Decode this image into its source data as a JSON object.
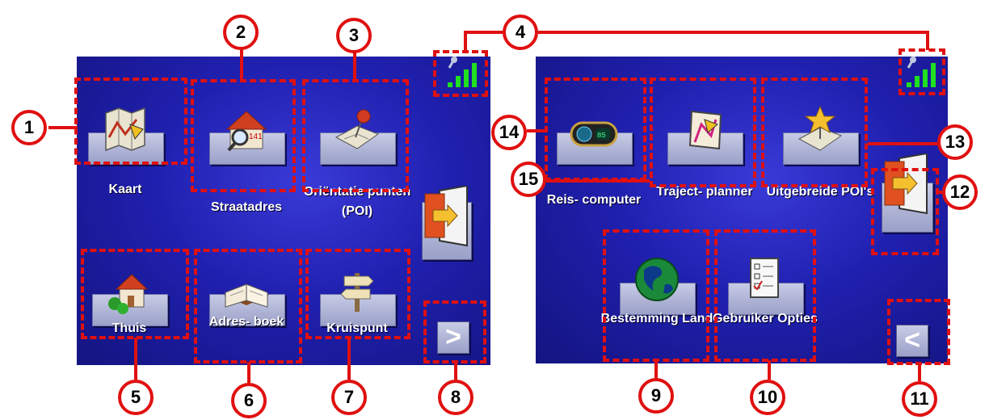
{
  "screen1": {
    "buttons": [
      {
        "label": "Kaart",
        "icon": "map-icon"
      },
      {
        "label": "Straatadres",
        "icon": "house-search-icon"
      },
      {
        "label": "Oriëntatie punten (POI)",
        "icon": "poi-pin-icon"
      },
      {
        "label": "Thuis",
        "icon": "home-icon"
      },
      {
        "label": "Adres- boek",
        "icon": "address-book-icon"
      },
      {
        "label": "Kruispunt",
        "icon": "signpost-icon"
      }
    ],
    "next_label": ">"
  },
  "screen2": {
    "buttons": [
      {
        "label": "Reis- computer",
        "icon": "trip-computer-icon"
      },
      {
        "label": "Traject- planner",
        "icon": "route-planner-icon"
      },
      {
        "label": "Uitgebreide POI's",
        "icon": "extended-poi-icon"
      },
      {
        "label": "Bestemming Land",
        "icon": "globe-icon"
      },
      {
        "label": "Gebruiker Opties",
        "icon": "checklist-icon"
      }
    ],
    "back_label": "<"
  },
  "callouts": [
    "1",
    "2",
    "3",
    "4",
    "5",
    "6",
    "7",
    "8",
    "9",
    "10",
    "11",
    "12",
    "13",
    "14",
    "15"
  ],
  "colors": {
    "accent": "#e01010",
    "screen": "#2020b0"
  }
}
